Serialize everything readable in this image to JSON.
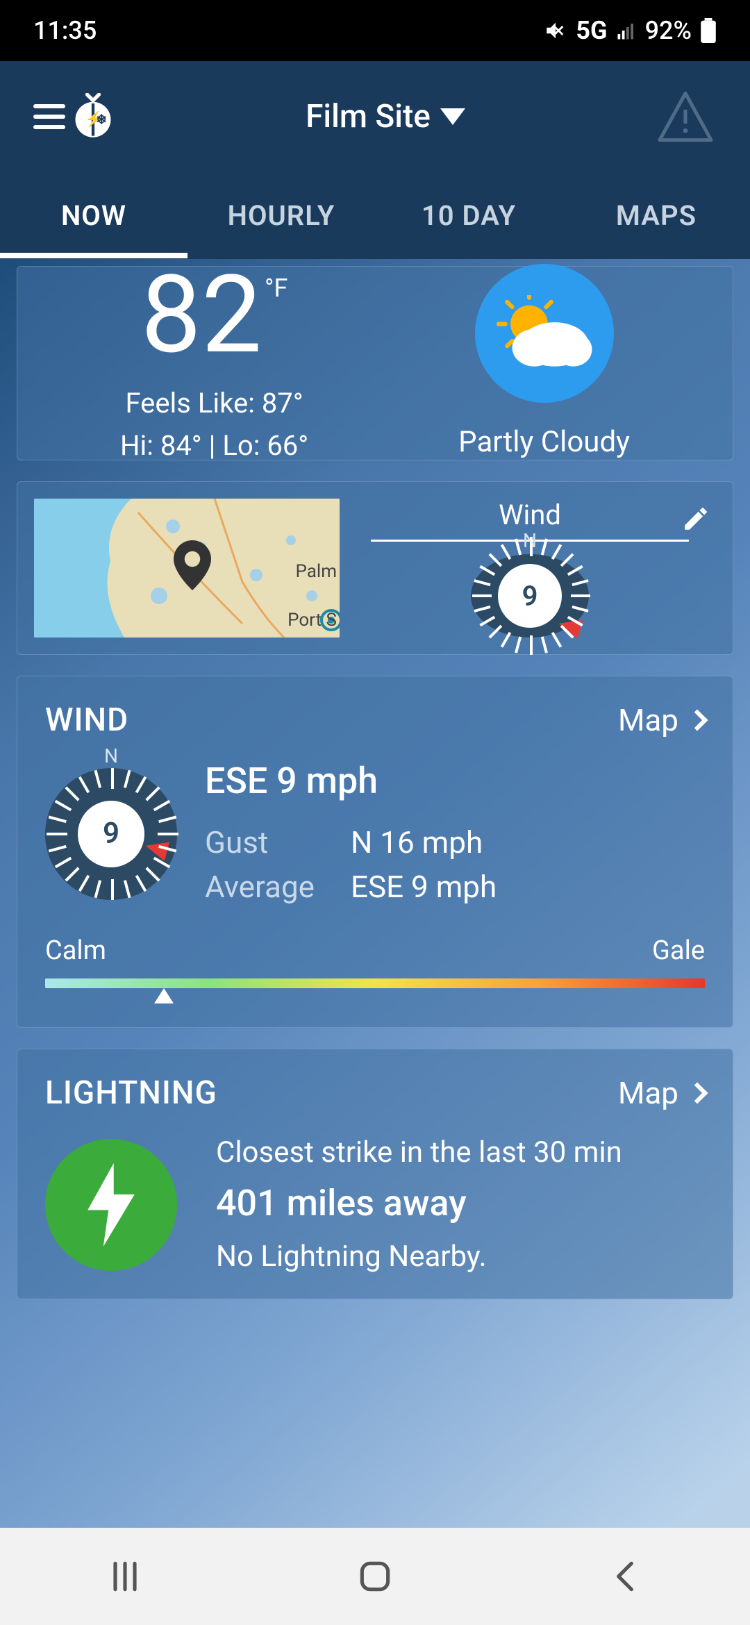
{
  "status": {
    "time": "11:35",
    "network": "5G",
    "battery": "92%"
  },
  "header": {
    "location": "Film Site"
  },
  "tabs": [
    "NOW",
    "HOURLY",
    "10 DAY",
    "MAPS"
  ],
  "active_tab": 0,
  "now": {
    "temp": "82",
    "unit": "°F",
    "feels_label": "Feels Like: 87°",
    "hilo": "Hi: 84° | Lo: 66°",
    "condition": "Partly Cloudy"
  },
  "mapwind": {
    "title": "Wind",
    "speed": "9",
    "map_labels": {
      "palm": "Palm",
      "ports": "Port S"
    }
  },
  "wind": {
    "section_title": "WIND",
    "map_link": "Map",
    "headline": "ESE 9 mph",
    "gust_label": "Gust",
    "gust_value": "N 16 mph",
    "avg_label": "Average",
    "avg_value": "ESE 9 mph",
    "compass_value": "9",
    "scale_low": "Calm",
    "scale_high": "Gale",
    "scale_position_pct": 18
  },
  "lightning": {
    "section_title": "LIGHTNING",
    "map_link": "Map",
    "line1": "Closest strike in the last 30 min",
    "line2": "401 miles away",
    "line3": "No Lightning Nearby."
  }
}
